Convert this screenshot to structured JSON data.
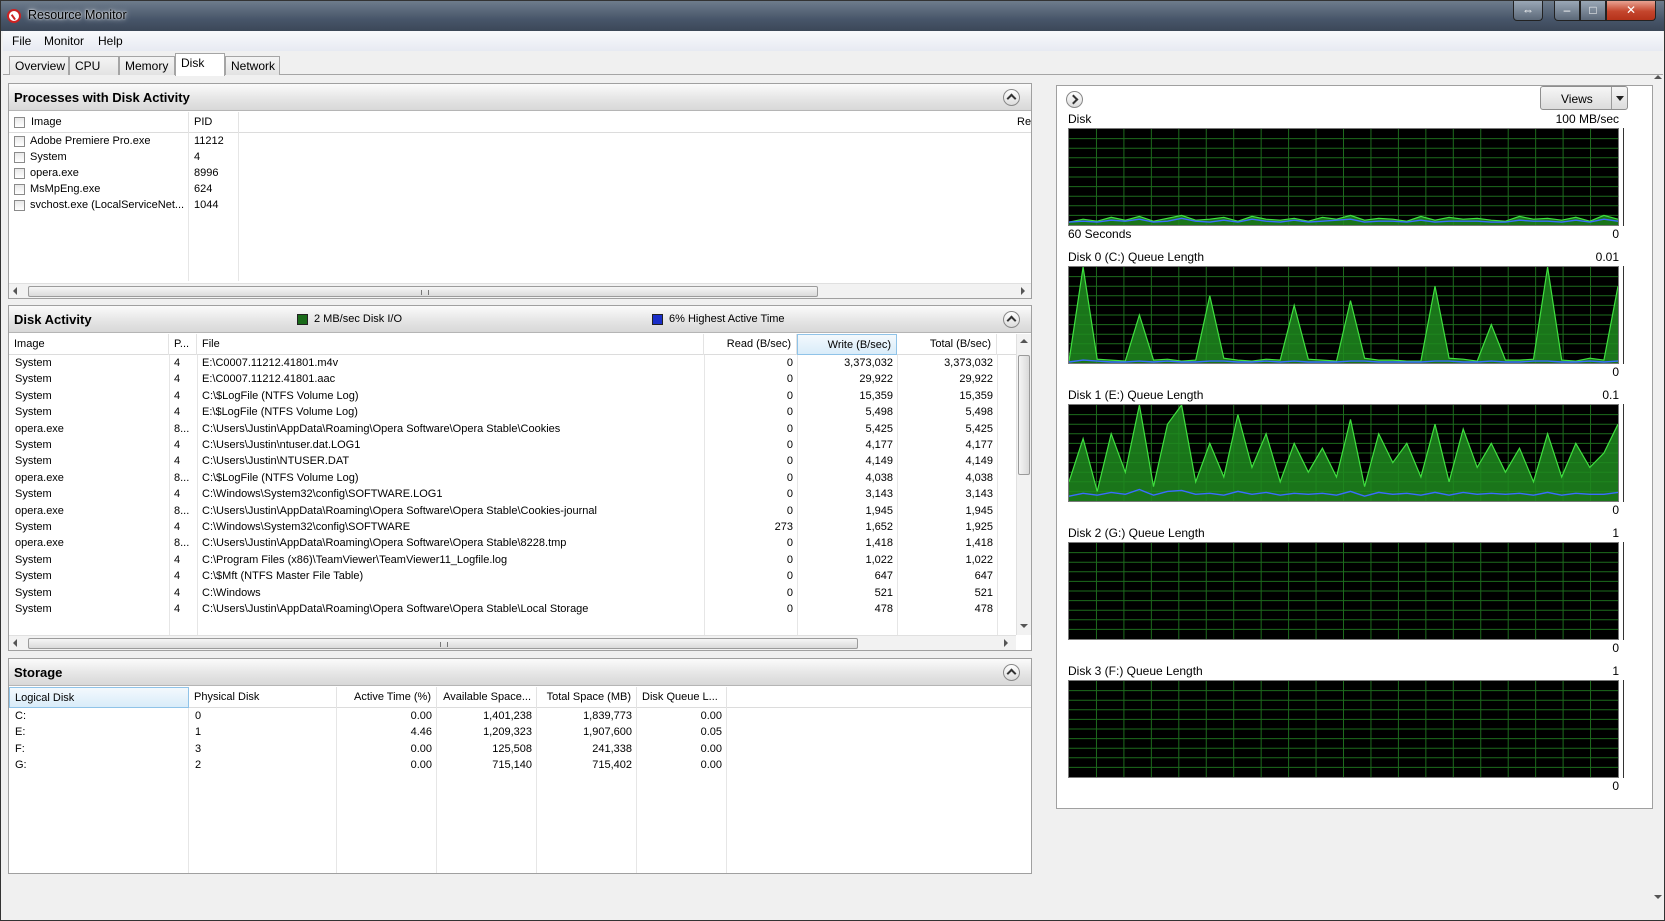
{
  "window": {
    "title": "Resource Monitor"
  },
  "menu": [
    "File",
    "Monitor",
    "Help"
  ],
  "tabs": [
    "Overview",
    "CPU",
    "Memory",
    "Disk",
    "Network"
  ],
  "processes": {
    "title": "Processes with Disk Activity",
    "columns": [
      "Image",
      "PID",
      "Re"
    ],
    "rows": [
      {
        "image": "Adobe Premiere Pro.exe",
        "pid": "11212",
        "extra": ""
      },
      {
        "image": "System",
        "pid": "4",
        "extra": ""
      },
      {
        "image": "opera.exe",
        "pid": "8996",
        "extra": ""
      },
      {
        "image": "MsMpEng.exe",
        "pid": "624",
        "extra": ""
      },
      {
        "image": "svchost.exe (LocalServiceNet...",
        "pid": "1044",
        "extra": ""
      }
    ]
  },
  "disk_activity": {
    "title": "Disk Activity",
    "legend_io": "2 MB/sec Disk I/O",
    "legend_active": "6% Highest Active Time",
    "columns": [
      "Image",
      "P...",
      "File",
      "Read (B/sec)",
      "Write (B/sec)",
      "Total (B/sec)"
    ],
    "rows": [
      {
        "image": "System",
        "pid": "4",
        "file": "E:\\C0007.11212.41801.m4v",
        "read": "0",
        "write": "3,373,032",
        "total": "3,373,032"
      },
      {
        "image": "System",
        "pid": "4",
        "file": "E:\\C0007.11212.41801.aac",
        "read": "0",
        "write": "29,922",
        "total": "29,922"
      },
      {
        "image": "System",
        "pid": "4",
        "file": "C:\\$LogFile (NTFS Volume Log)",
        "read": "0",
        "write": "15,359",
        "total": "15,359"
      },
      {
        "image": "System",
        "pid": "4",
        "file": "E:\\$LogFile (NTFS Volume Log)",
        "read": "0",
        "write": "5,498",
        "total": "5,498"
      },
      {
        "image": "opera.exe",
        "pid": "8...",
        "file": "C:\\Users\\Justin\\AppData\\Roaming\\Opera Software\\Opera Stable\\Cookies",
        "read": "0",
        "write": "5,425",
        "total": "5,425"
      },
      {
        "image": "System",
        "pid": "4",
        "file": "C:\\Users\\Justin\\ntuser.dat.LOG1",
        "read": "0",
        "write": "4,177",
        "total": "4,177"
      },
      {
        "image": "System",
        "pid": "4",
        "file": "C:\\Users\\Justin\\NTUSER.DAT",
        "read": "0",
        "write": "4,149",
        "total": "4,149"
      },
      {
        "image": "opera.exe",
        "pid": "8...",
        "file": "C:\\$LogFile (NTFS Volume Log)",
        "read": "0",
        "write": "4,038",
        "total": "4,038"
      },
      {
        "image": "System",
        "pid": "4",
        "file": "C:\\Windows\\System32\\config\\SOFTWARE.LOG1",
        "read": "0",
        "write": "3,143",
        "total": "3,143"
      },
      {
        "image": "opera.exe",
        "pid": "8...",
        "file": "C:\\Users\\Justin\\AppData\\Roaming\\Opera Software\\Opera Stable\\Cookies-journal",
        "read": "0",
        "write": "1,945",
        "total": "1,945"
      },
      {
        "image": "System",
        "pid": "4",
        "file": "C:\\Windows\\System32\\config\\SOFTWARE",
        "read": "273",
        "write": "1,652",
        "total": "1,925"
      },
      {
        "image": "opera.exe",
        "pid": "8...",
        "file": "C:\\Users\\Justin\\AppData\\Roaming\\Opera Software\\Opera Stable\\8228.tmp",
        "read": "0",
        "write": "1,418",
        "total": "1,418"
      },
      {
        "image": "System",
        "pid": "4",
        "file": "C:\\Program Files (x86)\\TeamViewer\\TeamViewer11_Logfile.log",
        "read": "0",
        "write": "1,022",
        "total": "1,022"
      },
      {
        "image": "System",
        "pid": "4",
        "file": "C:\\$Mft (NTFS Master File Table)",
        "read": "0",
        "write": "647",
        "total": "647"
      },
      {
        "image": "System",
        "pid": "4",
        "file": "C:\\Windows",
        "read": "0",
        "write": "521",
        "total": "521"
      },
      {
        "image": "System",
        "pid": "4",
        "file": "C:\\Users\\Justin\\AppData\\Roaming\\Opera Software\\Opera Stable\\Local Storage",
        "read": "0",
        "write": "478",
        "total": "478"
      }
    ]
  },
  "storage": {
    "title": "Storage",
    "columns": [
      "Logical Disk",
      "Physical Disk",
      "Active Time (%)",
      "Available Space...",
      "Total Space (MB)",
      "Disk Queue L..."
    ],
    "rows": [
      {
        "logical": "C:",
        "physical": "0",
        "active": "0.00",
        "available": "1,401,238",
        "total": "1,839,773",
        "queue": "0.00"
      },
      {
        "logical": "E:",
        "physical": "1",
        "active": "4.46",
        "available": "1,209,323",
        "total": "1,907,600",
        "queue": "0.05"
      },
      {
        "logical": "F:",
        "physical": "3",
        "active": "0.00",
        "available": "125,508",
        "total": "241,338",
        "queue": "0.00"
      },
      {
        "logical": "G:",
        "physical": "2",
        "active": "0.00",
        "available": "715,140",
        "total": "715,402",
        "queue": "0.00"
      }
    ]
  },
  "graphs": {
    "views_label": "Views",
    "items": [
      {
        "title": "Disk",
        "max": "100 MB/sec",
        "min": "0",
        "footer": "60 Seconds",
        "green": [
          3,
          6,
          4,
          8,
          5,
          9,
          4,
          7,
          10,
          5,
          6,
          8,
          4,
          9,
          6,
          5,
          7,
          4,
          8,
          6,
          10,
          5,
          7,
          6,
          4,
          9,
          5,
          8,
          6,
          7,
          5,
          4,
          9,
          6,
          7,
          5,
          8,
          4,
          10,
          6
        ],
        "blue": [
          3,
          4,
          3,
          5,
          4,
          6,
          3,
          4,
          7,
          4,
          3,
          5,
          3,
          6,
          4,
          3,
          5,
          3,
          4,
          5,
          6,
          3,
          4,
          4,
          3,
          5,
          3,
          4,
          4,
          4,
          3,
          3,
          5,
          4,
          4,
          3,
          5,
          3,
          6,
          4
        ]
      },
      {
        "title": "Disk 0 (C:) Queue Length",
        "max": "0.01",
        "min": "0",
        "green": [
          2,
          100,
          4,
          3,
          2,
          50,
          3,
          4,
          2,
          3,
          70,
          5,
          3,
          2,
          4,
          3,
          60,
          4,
          3,
          2,
          65,
          5,
          3,
          3,
          2,
          2,
          80,
          5,
          4,
          2,
          40,
          3,
          3,
          4,
          100,
          3,
          2,
          5,
          3,
          80
        ],
        "blue": [
          1,
          3,
          2,
          1,
          1,
          2,
          1,
          2,
          1,
          1,
          2,
          2,
          1,
          1,
          2,
          1,
          2,
          1,
          1,
          1,
          2,
          2,
          1,
          1,
          1,
          1,
          2,
          2,
          1,
          1,
          2,
          1,
          1,
          2,
          2,
          1,
          1,
          2,
          1,
          2
        ]
      },
      {
        "title": "Disk 1 (E:) Queue Length",
        "max": "0.1",
        "min": "0",
        "green": [
          20,
          65,
          10,
          70,
          30,
          100,
          15,
          80,
          100,
          20,
          60,
          25,
          90,
          35,
          70,
          20,
          60,
          30,
          55,
          25,
          85,
          15,
          70,
          40,
          60,
          25,
          80,
          20,
          75,
          35,
          60,
          30,
          55,
          20,
          70,
          25,
          60,
          35,
          50,
          80
        ],
        "blue": [
          5,
          8,
          6,
          9,
          7,
          12,
          6,
          10,
          11,
          7,
          8,
          6,
          10,
          7,
          9,
          6,
          8,
          7,
          8,
          6,
          10,
          5,
          9,
          7,
          8,
          6,
          9,
          6,
          9,
          7,
          8,
          7,
          8,
          6,
          9,
          6,
          8,
          7,
          7,
          9
        ]
      },
      {
        "title": "Disk 2 (G:) Queue Length",
        "max": "1",
        "min": "0",
        "green": [],
        "blue": []
      },
      {
        "title": "Disk 3 (F:) Queue Length",
        "max": "1",
        "min": "0",
        "green": [],
        "blue": []
      }
    ]
  }
}
